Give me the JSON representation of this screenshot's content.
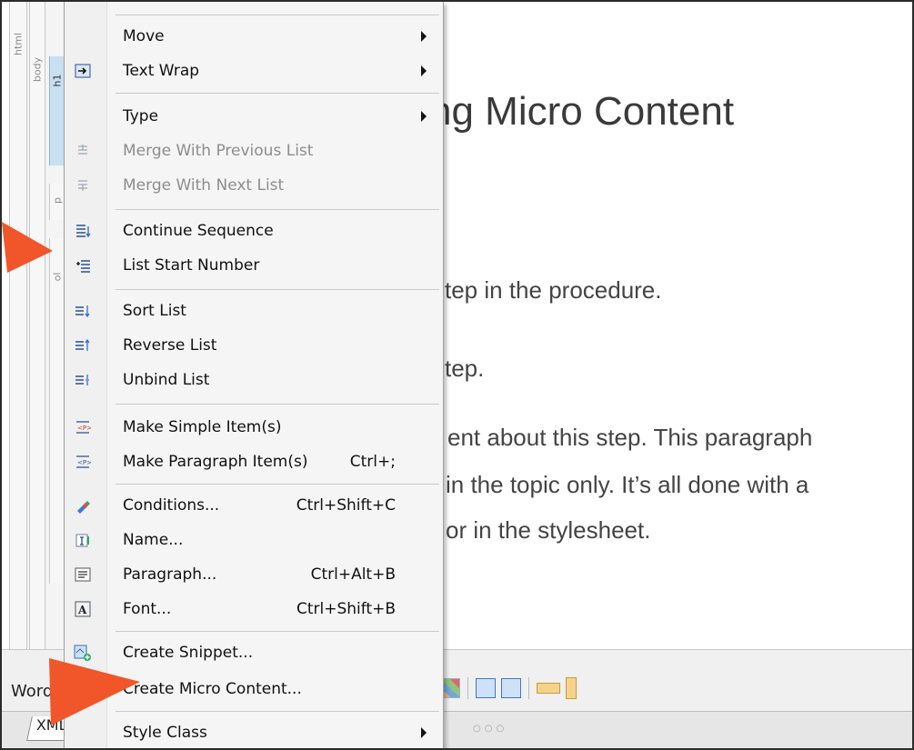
{
  "structure_bars": {
    "html": "html",
    "body": "body",
    "h1": "h1",
    "p": "p",
    "ol": "ol"
  },
  "editor": {
    "heading": "ng Micro Content",
    "colon": ":",
    "line1": "step in the procedure.",
    "line2": "step.",
    "line3": "ent about this step. This paragraph",
    "line4": "in the topic only. It’s all done with a",
    "line5": "or in the stylesheet."
  },
  "bottom": {
    "word_tab": "Word",
    "xml_tab": "XML",
    "dots": "○○○"
  },
  "menu": {
    "items": [
      {
        "label": "Move",
        "icon": "",
        "submenu": true,
        "disabled": false,
        "shortcut": ""
      },
      {
        "label": "Text Wrap",
        "icon": "text-wrap-icon",
        "submenu": true,
        "disabled": false,
        "shortcut": ""
      },
      {
        "label": "Type",
        "icon": "",
        "submenu": true,
        "disabled": false,
        "shortcut": ""
      },
      {
        "label": "Merge With Previous List",
        "icon": "merge-previous-icon",
        "submenu": false,
        "disabled": true,
        "shortcut": ""
      },
      {
        "label": "Merge With Next List",
        "icon": "merge-next-icon",
        "submenu": false,
        "disabled": true,
        "shortcut": ""
      },
      {
        "label": "Continue Sequence",
        "icon": "continue-sequence-icon",
        "submenu": false,
        "disabled": false,
        "shortcut": ""
      },
      {
        "label": "List Start Number",
        "icon": "list-start-number-icon",
        "submenu": false,
        "disabled": false,
        "shortcut": ""
      },
      {
        "label": "Sort List",
        "icon": "sort-list-icon",
        "submenu": false,
        "disabled": false,
        "shortcut": ""
      },
      {
        "label": "Reverse List",
        "icon": "reverse-list-icon",
        "submenu": false,
        "disabled": false,
        "shortcut": ""
      },
      {
        "label": "Unbind List",
        "icon": "unbind-list-icon",
        "submenu": false,
        "disabled": false,
        "shortcut": ""
      },
      {
        "label": "Make Simple Item(s)",
        "icon": "make-simple-item-icon",
        "submenu": false,
        "disabled": false,
        "shortcut": ""
      },
      {
        "label": "Make Paragraph Item(s)",
        "icon": "make-paragraph-item-icon",
        "submenu": false,
        "disabled": false,
        "shortcut": "Ctrl+;"
      },
      {
        "label": "Conditions...",
        "icon": "conditions-icon",
        "submenu": false,
        "disabled": false,
        "shortcut": "Ctrl+Shift+C"
      },
      {
        "label": "Name...",
        "icon": "name-icon",
        "submenu": false,
        "disabled": false,
        "shortcut": ""
      },
      {
        "label": "Paragraph...",
        "icon": "paragraph-icon",
        "submenu": false,
        "disabled": false,
        "shortcut": "Ctrl+Alt+B"
      },
      {
        "label": "Font...",
        "icon": "font-icon",
        "submenu": false,
        "disabled": false,
        "shortcut": "Ctrl+Shift+B"
      },
      {
        "label": "Create Snippet...",
        "icon": "create-snippet-icon",
        "submenu": false,
        "disabled": false,
        "shortcut": ""
      },
      {
        "label": "Create Micro Content...",
        "icon": "",
        "submenu": false,
        "disabled": false,
        "shortcut": ""
      },
      {
        "label": "Style Class",
        "icon": "",
        "submenu": true,
        "disabled": false,
        "shortcut": ""
      }
    ]
  },
  "colors": {
    "callout": "#f0562a",
    "menu_bg": "#f5f5f5",
    "disabled_text": "#8d8d8d"
  }
}
